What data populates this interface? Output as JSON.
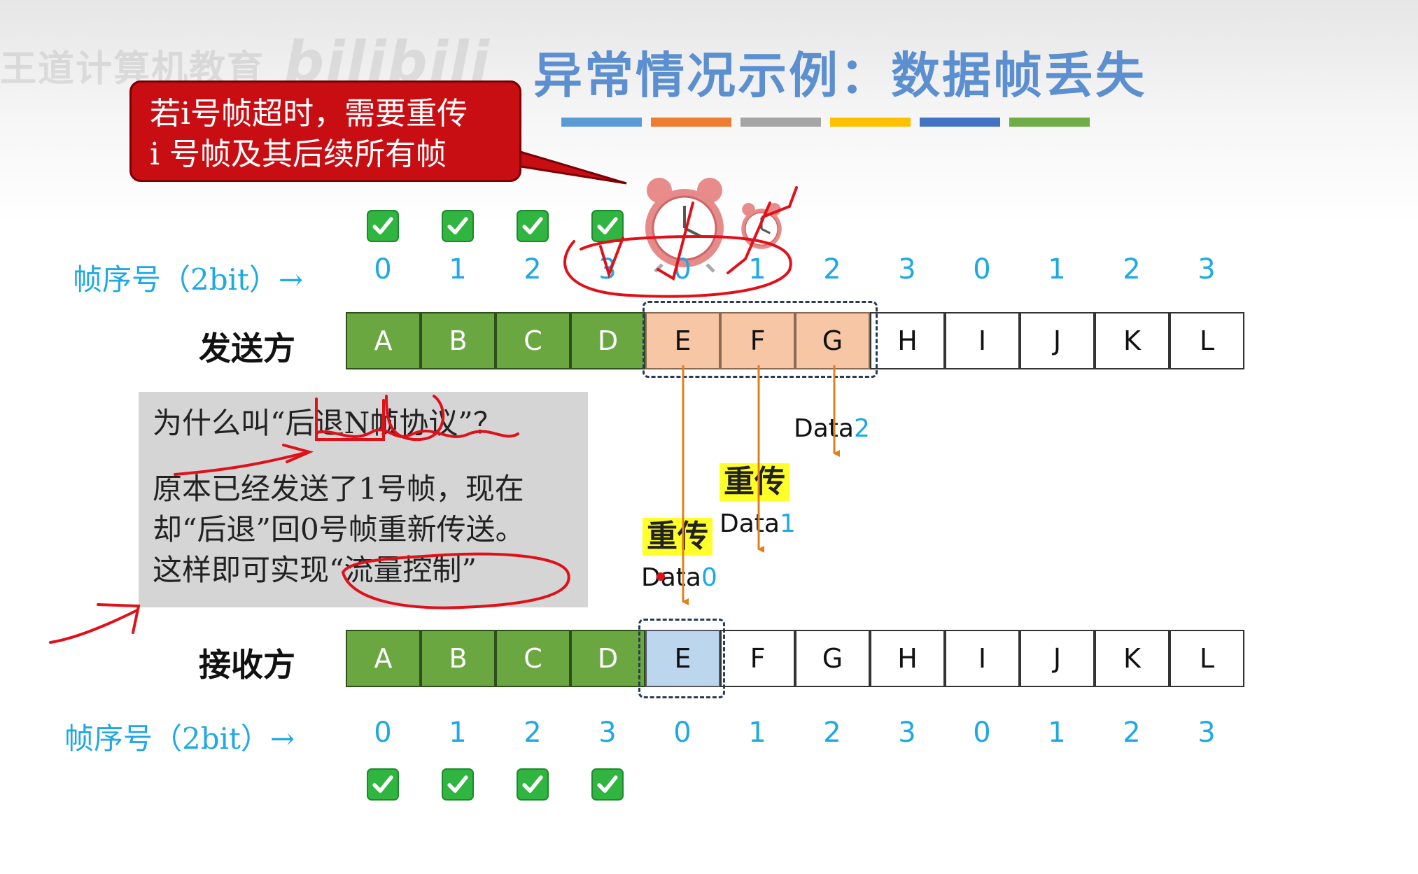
{
  "title": "异常情况示例：数据帧丢失",
  "title_underline_colors": [
    "#5b9bd5",
    "#ed7d31",
    "#a5a5a5",
    "#ffc000",
    "#4472c4",
    "#70ad47"
  ],
  "callout": {
    "line1": "若i号帧超时，需要重传",
    "line2": "i 号帧及其后续所有帧"
  },
  "sender": {
    "seq_label": "帧序号（2bit）→",
    "seq_numbers": [
      "0",
      "1",
      "2",
      "3",
      "0",
      "1",
      "2",
      "3",
      "0",
      "1",
      "2",
      "3"
    ],
    "row_label": "发送方",
    "frames": [
      "A",
      "B",
      "C",
      "D",
      "E",
      "F",
      "G",
      "H",
      "I",
      "J",
      "K",
      "L"
    ],
    "acked_count": 4
  },
  "receiver": {
    "seq_label": "帧序号（2bit）→",
    "seq_numbers": [
      "0",
      "1",
      "2",
      "3",
      "0",
      "1",
      "2",
      "3",
      "0",
      "1",
      "2",
      "3"
    ],
    "row_label": "接收方",
    "frames": [
      "A",
      "B",
      "C",
      "D",
      "E",
      "F",
      "G",
      "H",
      "I",
      "J",
      "K",
      "L"
    ],
    "received_count": 4
  },
  "note": {
    "question": "为什么叫“后退N帧协议”？",
    "answer_line1": "原本已经发送了1号帧，现在",
    "answer_line2": "却“后退”回0号帧重新传送。",
    "answer_line3": "这样即可实现“流量控制”"
  },
  "transmissions": [
    {
      "prefix": "Data",
      "index": "0",
      "resend": "重传"
    },
    {
      "prefix": "Data",
      "index": "1",
      "resend": "重传"
    },
    {
      "prefix": "Data",
      "index": "2"
    }
  ],
  "watermark": {
    "text": "王道计算机教育",
    "logo": "bilibili"
  },
  "colors": {
    "accent_blue": "#1ea8e4",
    "ack_green": "#30b540",
    "frame_green": "#6ba741",
    "window_orange": "#f6c6a5",
    "window_blue": "#bcd6ee",
    "callout_red": "#c80e13",
    "annotation_red": "#e0101a",
    "arrow_orange": "#e0801c",
    "resend_yellow": "#ffff2a"
  }
}
